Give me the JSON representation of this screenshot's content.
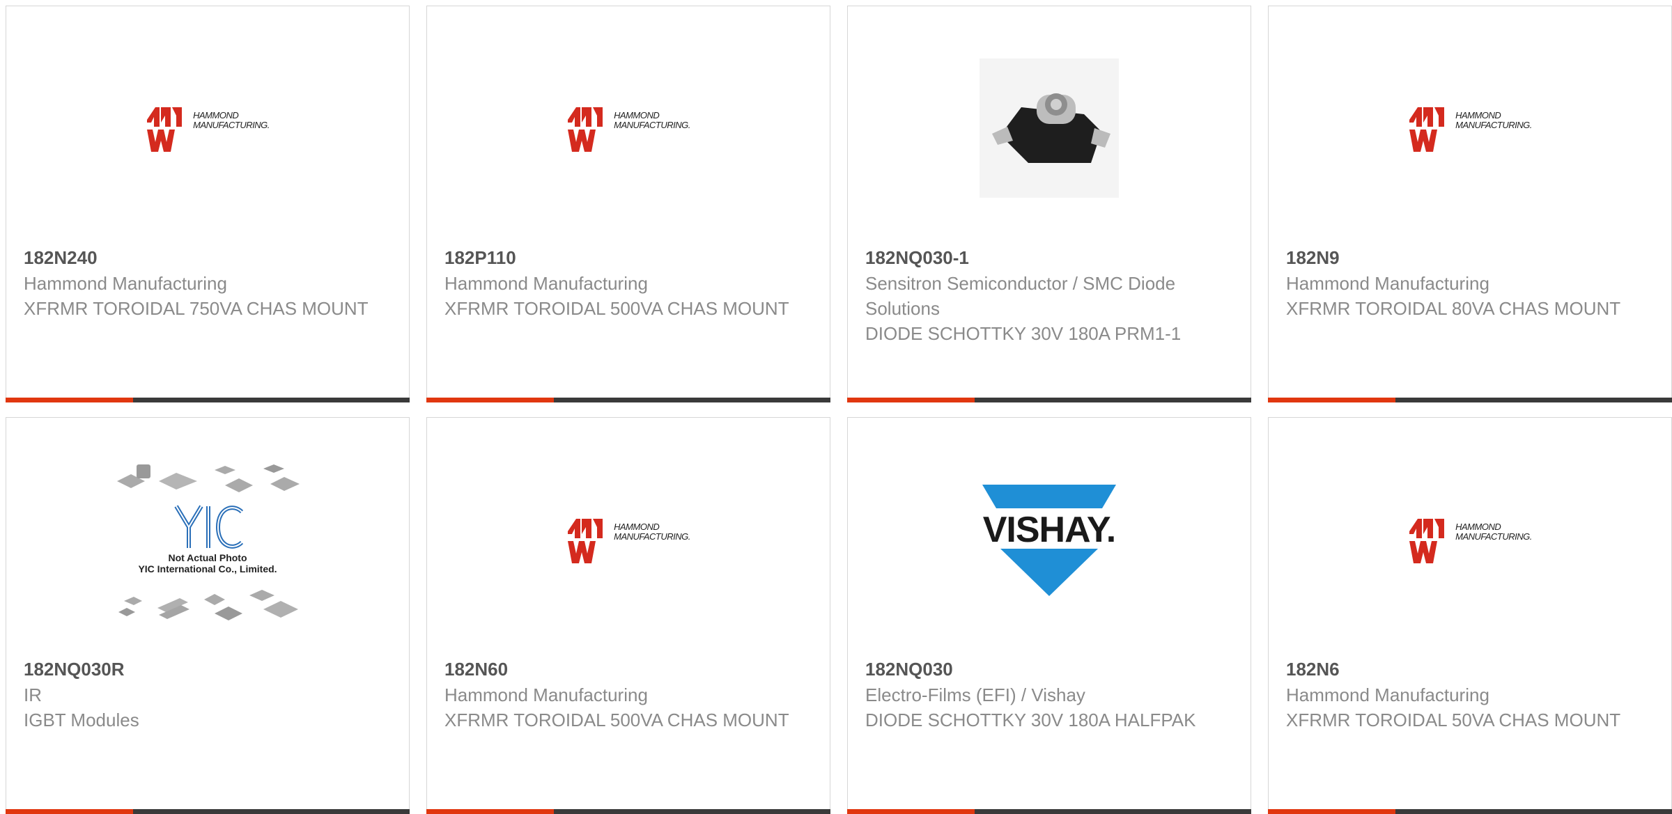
{
  "products": [
    {
      "part_number": "182N240",
      "manufacturer": "Hammond Manufacturing",
      "description": "XFRMR TOROIDAL 750VA CHAS MOUNT",
      "image": "hammond-logo"
    },
    {
      "part_number": "182P110",
      "manufacturer": "Hammond Manufacturing",
      "description": "XFRMR TOROIDAL 500VA CHAS MOUNT",
      "image": "hammond-logo"
    },
    {
      "part_number": "182NQ030-1",
      "manufacturer": "Sensitron Semiconductor / SMC Diode Solutions",
      "description": "DIODE SCHOTTKY 30V 180A PRM1-1",
      "image": "diode-module-photo"
    },
    {
      "part_number": "182N9",
      "manufacturer": "Hammond Manufacturing",
      "description": "XFRMR TOROIDAL 80VA CHAS MOUNT",
      "image": "hammond-logo"
    },
    {
      "part_number": "182NQ030R",
      "manufacturer": "IR",
      "description": "IGBT Modules",
      "image": "yic-placeholder"
    },
    {
      "part_number": "182N60",
      "manufacturer": "Hammond Manufacturing",
      "description": "XFRMR TOROIDAL 500VA CHAS MOUNT",
      "image": "hammond-logo"
    },
    {
      "part_number": "182NQ030",
      "manufacturer": "Electro-Films (EFI) / Vishay",
      "description": "DIODE SCHOTTKY 30V 180A HALFPAK",
      "image": "vishay-logo"
    },
    {
      "part_number": "182N6",
      "manufacturer": "Hammond Manufacturing",
      "description": "XFRMR TOROIDAL 50VA CHAS MOUNT",
      "image": "hammond-logo"
    }
  ],
  "logos": {
    "hammond_line1": "HAMMOND",
    "hammond_line2": "MANUFACTURING.",
    "vishay": "VISHAY.",
    "yic_line1": "Not Actual Photo",
    "yic_line2": "YIC International Co., Limited."
  },
  "colors": {
    "accent": "#e1370f",
    "bar": "#3a3a3a",
    "hammond_red": "#d42a1e",
    "vishay_blue": "#1f8fd6"
  }
}
